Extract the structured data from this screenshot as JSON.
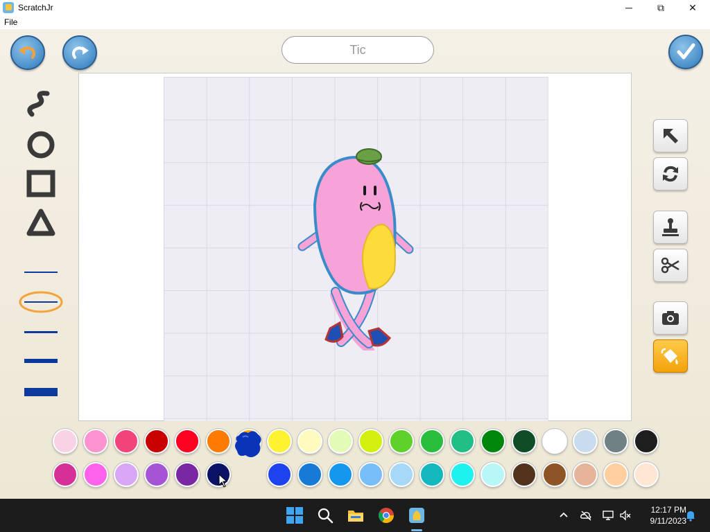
{
  "window": {
    "title": "ScratchJr",
    "minimize_glyph": "─",
    "maximize_glyph": "⧉",
    "close_glyph": "✕"
  },
  "menu": {
    "file": "File"
  },
  "editor": {
    "character_name": "Tic",
    "undo_icon": "undo-arrow",
    "redo_icon": "redo-arrow",
    "done_icon": "checkmark",
    "shape_tools": [
      "freehand-line-icon",
      "ellipse-icon",
      "rectangle-icon",
      "triangle-icon"
    ],
    "line_widths": [
      "thinnest",
      "thin",
      "medium",
      "thick",
      "thickest"
    ],
    "selected_line_width": "thin",
    "right_tools": [
      "move",
      "rotate",
      "duplicate",
      "cut",
      "camera",
      "fill"
    ],
    "active_tool": "fill"
  },
  "palette": {
    "row1": [
      "#f9d2e6",
      "#fb93cf",
      "#f2437a",
      "#c80000",
      "#ff0020",
      "#ff7a00",
      "#ffa800",
      "#fff231",
      "#fffbbf",
      "#e2fbb6",
      "#d2ef0d",
      "#5ed12b",
      "#29be3b",
      "#22bf85",
      "#00860a",
      "#0f4d27",
      "#ffffff",
      "#c8dced",
      "#6f8185",
      "#1e1e1e"
    ],
    "row2": [
      "#d62f97",
      "#fe61ea",
      "#d9a6f5",
      "#a554d6",
      "#7a27a2",
      "#0c1367",
      "#0a34b8",
      "#1d43f0",
      "#157bd7",
      "#1597f0",
      "#77bdf8",
      "#a8d8f7",
      "#12b8bd",
      "#1ef2ef",
      "#b8f7f7",
      "#52331c",
      "#8d5426",
      "#e8b499",
      "#ffcf9e",
      "#ffe6d2"
    ],
    "selected": "#0a34b8"
  },
  "taskbar": {
    "apps": [
      "windows-start",
      "search",
      "file-explorer",
      "chrome",
      "scratchjr"
    ],
    "time": "12:17 PM",
    "date": "9/11/2023"
  }
}
